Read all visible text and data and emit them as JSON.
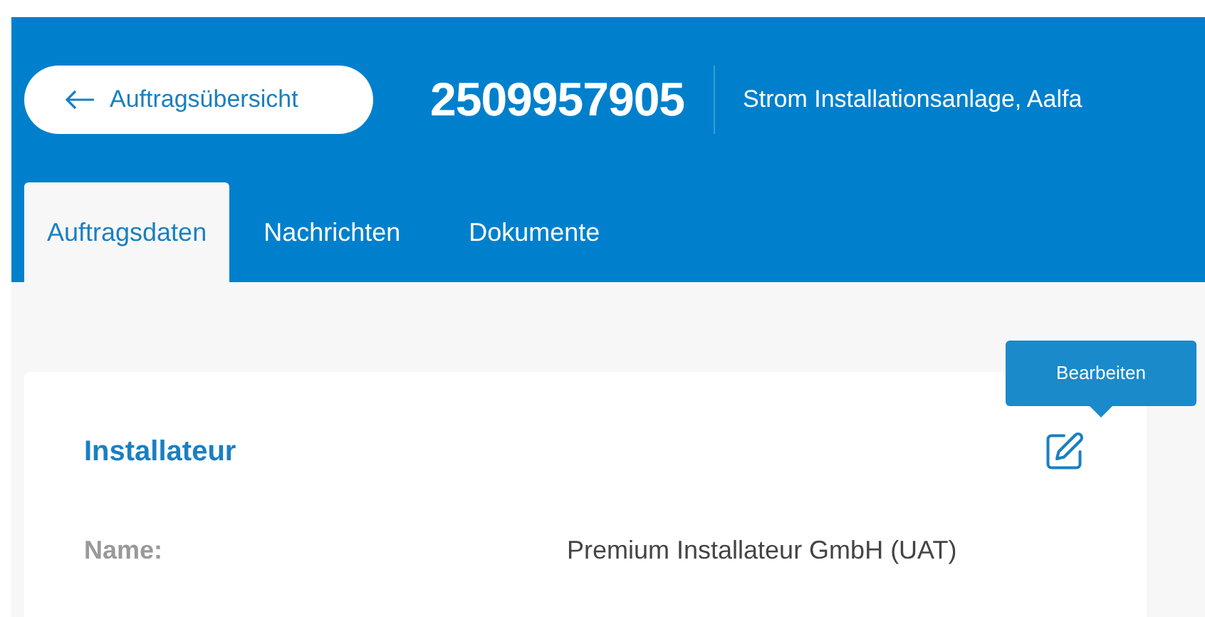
{
  "header": {
    "back_button": {
      "label": "Auftragsübersicht"
    },
    "order_number": "2509957905",
    "subtitle": "Strom Installationsanlage, Aalfa"
  },
  "tabs": [
    {
      "label": "Auftragsdaten",
      "selected": true
    },
    {
      "label": "Nachrichten",
      "selected": false
    },
    {
      "label": "Dokumente",
      "selected": false
    }
  ],
  "card": {
    "title": "Installateur",
    "edit_tooltip": "Bearbeiten",
    "fields": [
      {
        "label": "Name:",
        "value": "Premium Installateur GmbH (UAT)"
      }
    ]
  }
}
